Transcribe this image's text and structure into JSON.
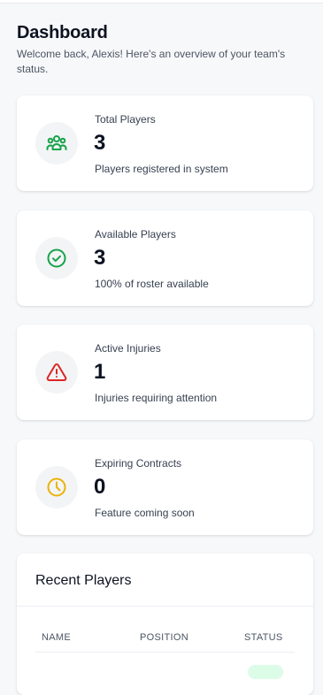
{
  "header": {
    "title": "Dashboard",
    "subtitle": "Welcome back, Alexis! Here's an overview of your team's status."
  },
  "stats": [
    {
      "label": "Total Players",
      "value": "3",
      "note": "Players registered in system",
      "icon": "users-icon",
      "color": "#16a34a"
    },
    {
      "label": "Available Players",
      "value": "3",
      "note": "100% of roster available",
      "icon": "check-circle-icon",
      "color": "#16a34a"
    },
    {
      "label": "Active Injuries",
      "value": "1",
      "note": "Injuries requiring attention",
      "icon": "alert-triangle-icon",
      "color": "#dc2626"
    },
    {
      "label": "Expiring Contracts",
      "value": "0",
      "note": "Feature coming soon",
      "icon": "clock-icon",
      "color": "#eab308"
    }
  ],
  "recent_players": {
    "title": "Recent Players",
    "columns": [
      "NAME",
      "POSITION",
      "STATUS"
    ],
    "status_color": "#dcfce7"
  }
}
